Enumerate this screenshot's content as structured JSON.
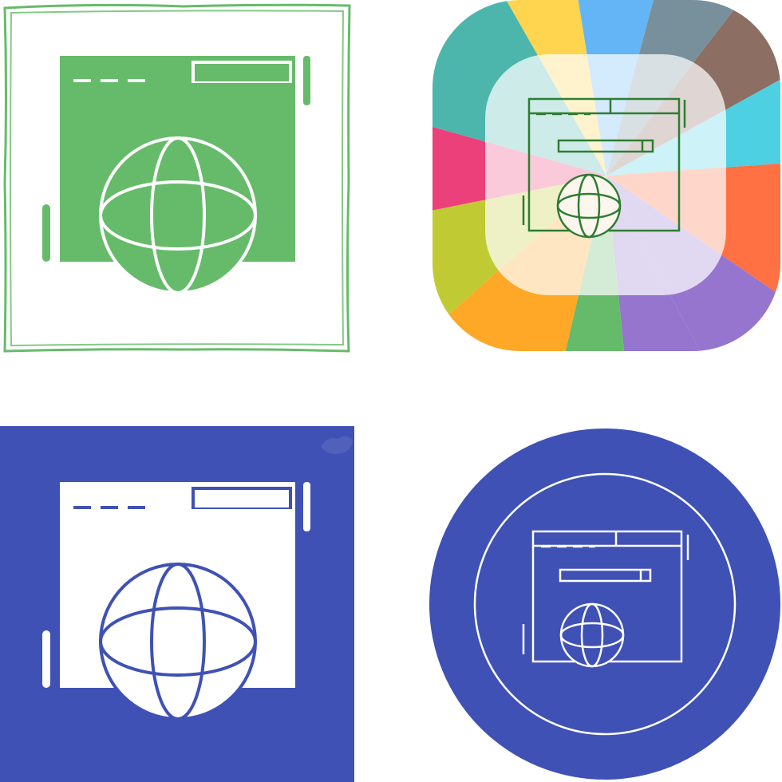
{
  "icon_set": {
    "subject": "browser-window-with-globe",
    "variants": [
      {
        "style": "glyph",
        "frame": "hand-drawn-square-outline",
        "colors": {
          "primary": "#66BB6A",
          "background": "#ffffff"
        }
      },
      {
        "style": "line",
        "frame": "rounded-square-multicolor-wheel",
        "colors": {
          "line": "#2E7D32",
          "wheel": [
            "#FFD54F",
            "#64B5F6",
            "#78909C",
            "#8D6E63",
            "#4DD0E1",
            "#FF7043",
            "#9575CD",
            "#66BB6A",
            "#FFA726",
            "#C0CA33",
            "#EC407A",
            "#4DB6AC"
          ]
        }
      },
      {
        "style": "glyph",
        "frame": "solid-square",
        "colors": {
          "primary": "#ffffff",
          "background": "#3F51B5"
        }
      },
      {
        "style": "line",
        "frame": "solid-circle-with-ring",
        "colors": {
          "line": "#ffffff",
          "background": "#3F51B5"
        }
      }
    ]
  }
}
